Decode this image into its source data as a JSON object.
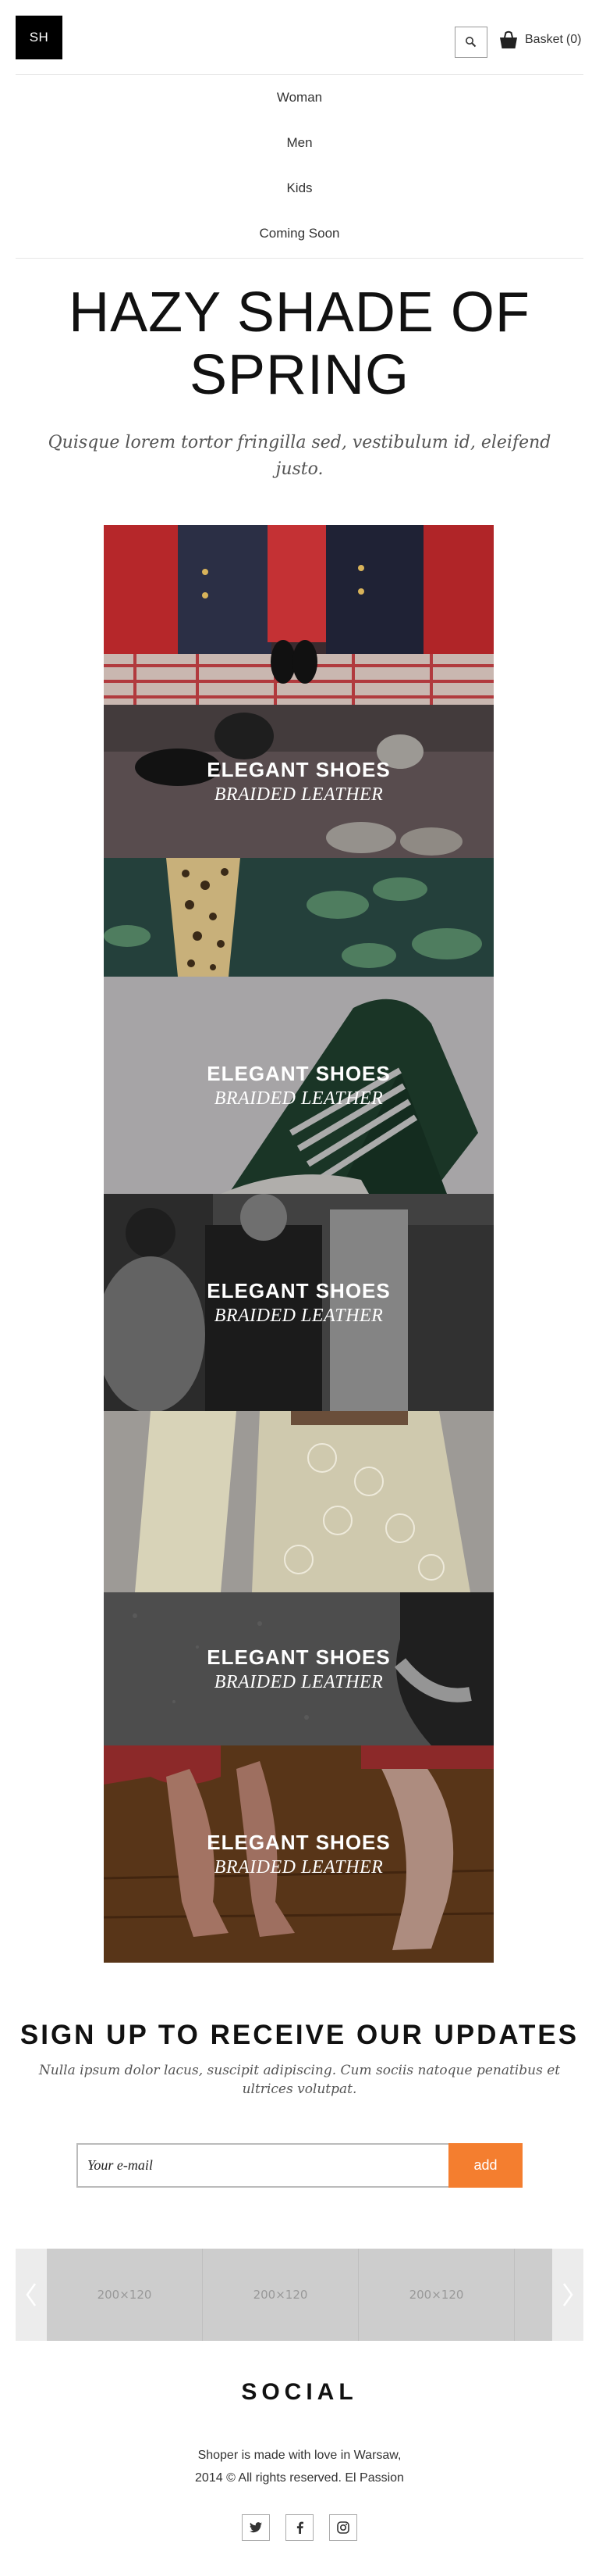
{
  "header": {
    "logo": "SH",
    "basket_label": "Basket",
    "basket_count": "(0)"
  },
  "nav": {
    "items": [
      "Woman",
      "Men",
      "Kids",
      "Coming Soon"
    ]
  },
  "hero": {
    "title": "HAZY SHADE OF SPRING",
    "subtitle": "Quisque lorem tortor fringilla sed, vestibulum id, eleifend justo."
  },
  "tiles": [
    {
      "title": "",
      "subtitle": ""
    },
    {
      "title": "ELEGANT SHOES",
      "subtitle": "BRAIDED LEATHER"
    },
    {
      "title": "",
      "subtitle": ""
    },
    {
      "title": "ELEGANT SHOES",
      "subtitle": "BRAIDED LEATHER"
    },
    {
      "title": "ELEGANT SHOES",
      "subtitle": "BRAIDED LEATHER"
    },
    {
      "title": "",
      "subtitle": ""
    },
    {
      "title": "ELEGANT SHOES",
      "subtitle": "BRAIDED LEATHER"
    },
    {
      "title": "ELEGANT SHOES",
      "subtitle": "BRAIDED LEATHER"
    }
  ],
  "signup": {
    "title": "SIGN UP TO RECEIVE OUR UPDATES",
    "subtitle": "Nulla ipsum dolor lacus, suscipit adipiscing. Cum sociis natoque penatibus et ultrices volutpat.",
    "email_placeholder": "Your e-mail",
    "button_label": "add",
    "button_color": "#f47e2f"
  },
  "carousel": {
    "slides": [
      "200×120",
      "200×120",
      "200×120",
      "200×120"
    ]
  },
  "social": {
    "title": "SOCIAL",
    "footer_line1": "Shoper is made with love in Warsaw,",
    "footer_line2": "2014 © All rights reserved. El Passion",
    "icons": [
      "twitter-icon",
      "facebook-icon",
      "instagram-icon"
    ]
  }
}
